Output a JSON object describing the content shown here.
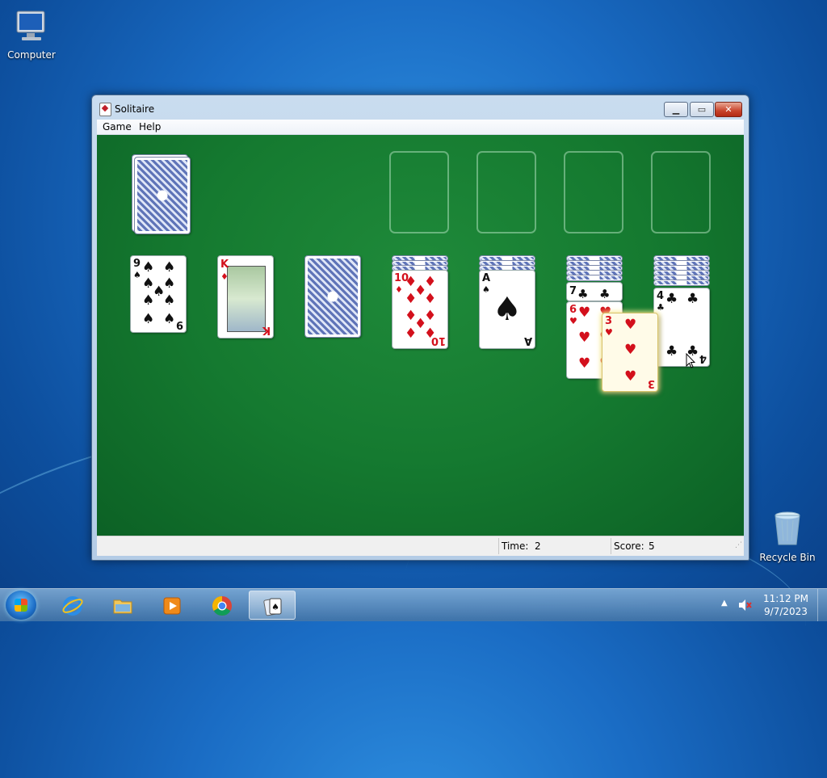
{
  "desktop": {
    "icons": [
      {
        "label": "Computer",
        "icon": "computer-icon"
      },
      {
        "label": "Recycle Bin",
        "icon": "recycle-bin-icon"
      }
    ]
  },
  "window": {
    "title": "Solitaire",
    "menu": [
      "Game",
      "Help"
    ],
    "controls": {
      "minimize": "minimize-button",
      "maximize": "maximize-button",
      "close": "close-button"
    }
  },
  "game": {
    "stock": {
      "face_down": true
    },
    "foundations": [
      "empty",
      "empty",
      "empty",
      "empty"
    ],
    "tableau": [
      {
        "hidden": 0,
        "face_up": [
          {
            "rank": "9",
            "suit": "♠",
            "color": "black"
          }
        ]
      },
      {
        "hidden": 0,
        "face_up": [
          {
            "rank": "K",
            "suit": "♦",
            "color": "red"
          }
        ]
      },
      {
        "hidden": 1,
        "face_up": []
      },
      {
        "hidden": 3,
        "face_up": [
          {
            "rank": "10",
            "suit": "♦",
            "color": "red"
          }
        ]
      },
      {
        "hidden": 3,
        "face_up": [
          {
            "rank": "A",
            "suit": "♠",
            "color": "black"
          }
        ]
      },
      {
        "hidden": 5,
        "face_up": [
          {
            "rank": "7",
            "suit": "♣",
            "color": "black"
          },
          {
            "rank": "6",
            "suit": "♥",
            "color": "red"
          }
        ]
      },
      {
        "hidden": 6,
        "face_up": [
          {
            "rank": "4",
            "suit": "♣",
            "color": "black"
          }
        ]
      }
    ],
    "dragging": {
      "rank": "3",
      "suit": "♥",
      "color": "red"
    }
  },
  "status": {
    "time_label": "Time:",
    "time_value": "2",
    "score_label": "Score:",
    "score_value": "5"
  },
  "taskbar": {
    "apps": [
      {
        "name": "internet-explorer",
        "icon": "internet-explorer-icon"
      },
      {
        "name": "file-explorer",
        "icon": "folder-icon"
      },
      {
        "name": "media-player",
        "icon": "media-player-icon"
      },
      {
        "name": "chrome",
        "icon": "chrome-icon"
      },
      {
        "name": "solitaire",
        "icon": "solitaire-icon",
        "active": true
      }
    ],
    "clock": {
      "time": "11:12 PM",
      "date": "9/7/2023"
    }
  }
}
